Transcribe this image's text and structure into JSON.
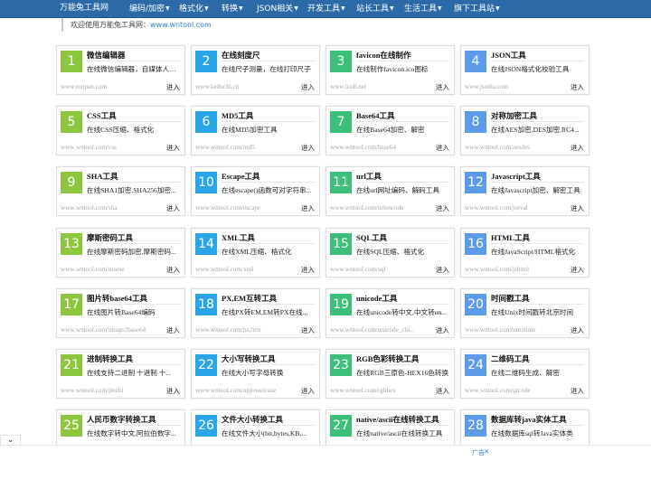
{
  "nav": {
    "items": [
      {
        "label": "万能兔工具网",
        "dropdown": false
      },
      {
        "label": "编码/加密",
        "dropdown": true
      },
      {
        "label": "格式化",
        "dropdown": true
      },
      {
        "label": "转换",
        "dropdown": true
      },
      {
        "label": "JSON相关",
        "dropdown": true
      },
      {
        "label": "开发工具",
        "dropdown": true
      },
      {
        "label": "站长工具",
        "dropdown": true
      },
      {
        "label": "生活工具",
        "dropdown": true
      },
      {
        "label": "旗下工具站",
        "dropdown": true
      }
    ],
    "background": "#2b6aa7"
  },
  "welcome": {
    "text": "欢迎使用万能兔工具网：",
    "link": "www.wntool.com"
  },
  "card_enter_label": "进入",
  "badge_colors": [
    "#8dc63f",
    "#2aa6e8",
    "#3bbf7a",
    "#5b9be8"
  ],
  "cards": [
    {
      "num": "1",
      "title": "微信编辑器",
      "desc": "在线微信编辑器，自媒体人必备...",
      "url": "www.roupan.com"
    },
    {
      "num": "2",
      "title": "在线刻度尺",
      "desc": "在线尺子测量，在线打印尺子",
      "url": "www.keduchi.cn"
    },
    {
      "num": "3",
      "title": "favicon在线制作",
      "desc": "在线制作favicon.ico图标",
      "url": "www.ico8.net"
    },
    {
      "num": "4",
      "title": "JSON工具",
      "desc": "在线JSON格式化校验工具",
      "url": "www.jsonla.com"
    },
    {
      "num": "5",
      "title": "CSS工具",
      "desc": "在线CSS压缩、格式化",
      "url": "www.wntool.com/css"
    },
    {
      "num": "6",
      "title": "MD5工具",
      "desc": "在线MD5加密工具",
      "url": "www.wntool.com/md5"
    },
    {
      "num": "7",
      "title": "Base64工具",
      "desc": "在线Base64加密、解密",
      "url": "www.wntool.com/base64"
    },
    {
      "num": "8",
      "title": "对称加密工具",
      "desc": "在线AES加密,DES加密,RC4...",
      "url": "www.wntool.com/aesdes"
    },
    {
      "num": "9",
      "title": "SHA工具",
      "desc": "在线SHA1加密,SHA256加密...",
      "url": "www.wntool.com/sha"
    },
    {
      "num": "10",
      "title": "Escape工具",
      "desc": "在线escape()函数可对字符串...",
      "url": "www.wntool.com/escape"
    },
    {
      "num": "11",
      "title": "url工具",
      "desc": "在线url网址编码、解码工具",
      "url": "www.wntool.com/urlencode"
    },
    {
      "num": "12",
      "title": "Javascript工具",
      "desc": "在线Javascript加密、解密工具",
      "url": "www.wntool.com/jseval"
    },
    {
      "num": "13",
      "title": "摩斯密码工具",
      "desc": "在线摩斯密码加密,摩斯密码...",
      "url": "www.wntool.com/morse"
    },
    {
      "num": "14",
      "title": "XML工具",
      "desc": "在线XML压缩、格式化",
      "url": "www.wntool.com/xml"
    },
    {
      "num": "15",
      "title": "SQL工具",
      "desc": "在线SQL压缩、格式化",
      "url": "www.wntool.com/sql"
    },
    {
      "num": "16",
      "title": "HTML工具",
      "desc": "在线JavaScript/HTML格式化",
      "url": "www.wntool.com/jshtml"
    },
    {
      "num": "17",
      "title": "图片转base64工具",
      "desc": "在线图片转Base64编码",
      "url": "www.wntool.com/image2base64"
    },
    {
      "num": "18",
      "title": "PX,EM互转工具",
      "desc": "在线PX转EM,EM转PX在线...",
      "url": "www.wntool.com/px2em"
    },
    {
      "num": "19",
      "title": "unicode工具",
      "desc": "在线unicode转中文,中文转un...",
      "url": "www.wntool.com/unicode_chi..."
    },
    {
      "num": "20",
      "title": "时间戳工具",
      "desc": "在线Unix时间戳转北京时间",
      "url": "www.wntool.com/unixtime"
    },
    {
      "num": "21",
      "title": "进制转换工具",
      "desc": "在线支持二进制 十进制 十...",
      "url": "www.wntool.com/jinzhi"
    },
    {
      "num": "22",
      "title": "大小写转换工具",
      "desc": "在线大小写字母转换",
      "url": "www.wntool.com/uplowercase"
    },
    {
      "num": "23",
      "title": "RGB色彩转换工具",
      "desc": "在线RGB三原色-HEX16色转换",
      "url": "www.wntool.com/rgbhex"
    },
    {
      "num": "24",
      "title": "二维码工具",
      "desc": "在线二维码生成、解密",
      "url": "www.wntool.com/qrcode"
    },
    {
      "num": "25",
      "title": "人民币数字转换工具",
      "desc": "在线数字转中文,阿拉伯数字...",
      "url": ""
    },
    {
      "num": "26",
      "title": "文件大小转换工具",
      "desc": "在线文件大小(bit,bytes,KB,...",
      "url": ""
    },
    {
      "num": "27",
      "title": "native/ascii在线转换工具",
      "desc": "在线native/ascii在线转换工具",
      "url": ""
    },
    {
      "num": "28",
      "title": "数据库转java实体工具",
      "desc": "在线数据库sql转Java实体类",
      "url": ""
    }
  ],
  "ad": {
    "label": "广告",
    "close": "✕"
  },
  "collapse_icon": "chevron-down"
}
